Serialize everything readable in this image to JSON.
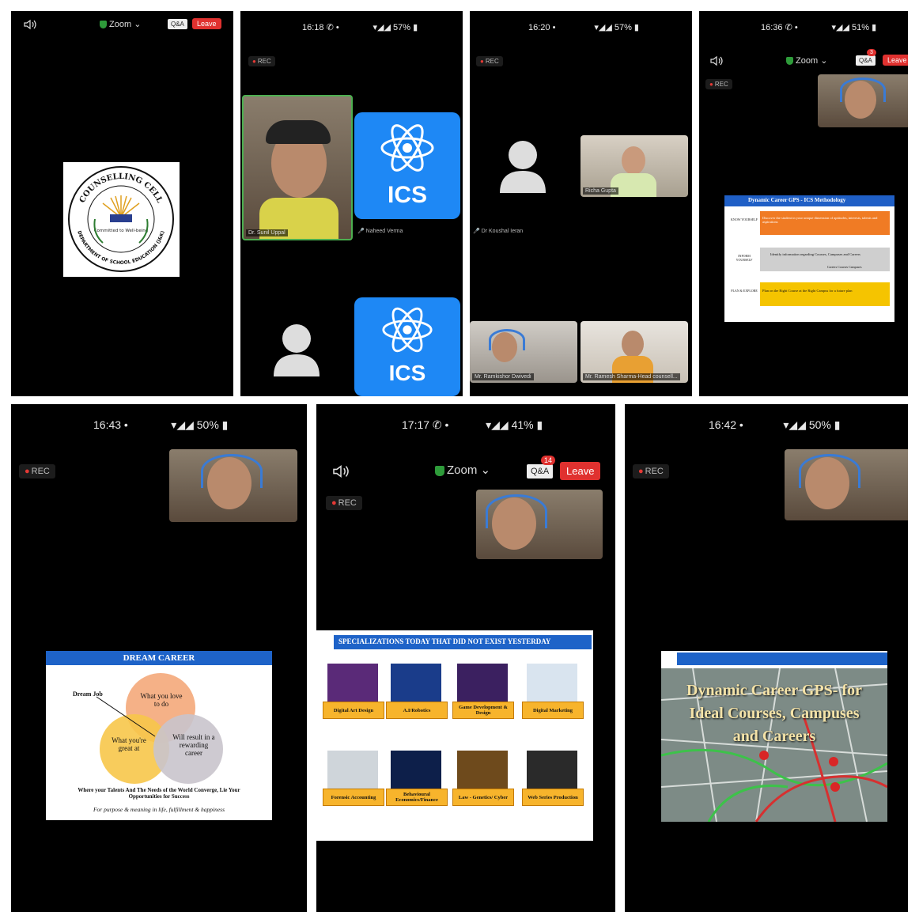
{
  "colors": {
    "leave": "#e0312f",
    "ics": "#1e88f5",
    "rec_dot": "#e53935",
    "shield": "#2e9b3a"
  },
  "common": {
    "rec": "REC",
    "zoom": "Zoom",
    "qa": "Q&A",
    "leave": "Leave"
  },
  "p1": {
    "logo": {
      "ring_top": "COUNSELLING CELL",
      "ring_bottom": "DEPARTMENT OF SCHOOL EDUCATION (J&K)",
      "center": "Committed to Well-being"
    }
  },
  "p2": {
    "status": "16:18",
    "battery": "57%",
    "ics_label": "ICS",
    "names": [
      "Dr. Sunil Uppal",
      "Naheed Verma"
    ]
  },
  "p3": {
    "status": "16:20",
    "battery": "57%",
    "names": [
      "Richa Gupta",
      "Dr Koushal Ieran",
      "Mr. Ramkishor Dwivedi",
      "Mr. Ramesh Sharma-Head counsell..."
    ]
  },
  "p4": {
    "status": "16:36",
    "battery": "51%",
    "badge": "3",
    "slide": {
      "title": "Dynamic Career GPS - ICS Methodology",
      "rows": [
        {
          "label": "KNOW YOURSELF",
          "text": "Discover the student in your unique dimension of aptitudes, interests, talents and aspirations"
        },
        {
          "label": "INFORM YOURSELF",
          "text": "Identify information regarding Courses, Campuses and Careers",
          "sub": "Careers Courses Campuses"
        },
        {
          "label": "PLAN & EXPLORE",
          "text": "Plan on the Right Course at the Right Campus for a future plan"
        }
      ]
    }
  },
  "p5": {
    "status": "16:43",
    "battery": "50%",
    "slide": {
      "title": "DREAM CAREER",
      "dream_job": "Dream Job",
      "love": "What you love to do",
      "great": "What you're great at",
      "reward": "Will result in a rewarding career",
      "caption": "Where your Talents And The Needs of the World Converge, Lie Your Opportunities for Success",
      "motto": "For purpose & meaning in life, fulfillment & happiness"
    }
  },
  "p6": {
    "status": "17:17",
    "battery": "41%",
    "badge": "14",
    "slide": {
      "title": "SPECIALIZATIONS TODAY THAT DID NOT EXIST YESTERDAY",
      "items": [
        "Digital Art Design",
        "A.I/Robotics",
        "Game Development & Design",
        "Digital Marketing",
        "Forensic Accounting",
        "Behavioural Economics/Finance",
        "Law - Genetics/ Cyber",
        "Web Series Production"
      ]
    }
  },
  "p7": {
    "status": "16:42",
    "battery": "50%",
    "slide": {
      "title": "Dynamic Career GPS- for Ideal Courses, Campuses and Careers"
    }
  }
}
